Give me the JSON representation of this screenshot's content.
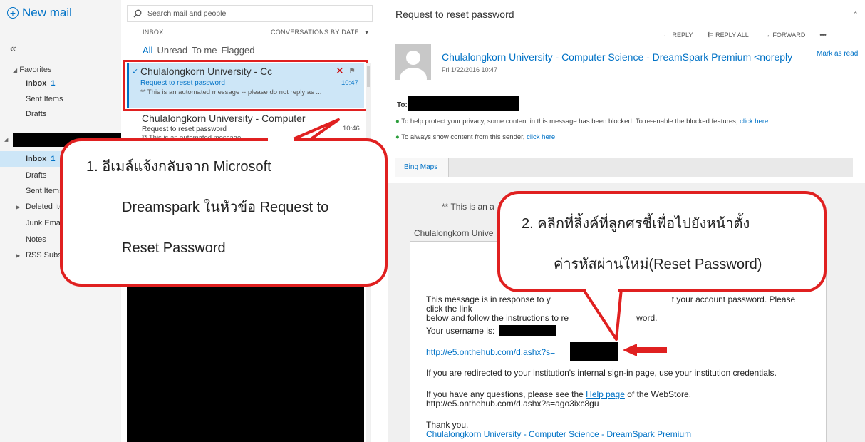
{
  "nav": {
    "new_mail": "New mail",
    "collapse": "«",
    "favorites": "Favorites",
    "fav_items": [
      {
        "label": "Inbox",
        "count": "1"
      },
      {
        "label": "Sent Items",
        "count": ""
      },
      {
        "label": "Drafts",
        "count": ""
      }
    ],
    "folders": [
      {
        "label": "Inbox",
        "count": "1"
      },
      {
        "label": "Drafts",
        "count": ""
      },
      {
        "label": "Sent Items",
        "count": ""
      },
      {
        "label": "Deleted Ite",
        "count": ""
      },
      {
        "label": "Junk Email",
        "count": ""
      },
      {
        "label": "Notes",
        "count": ""
      },
      {
        "label": "RSS Subsc",
        "count": ""
      }
    ]
  },
  "list": {
    "search_placeholder": "Search mail and people",
    "folder_label": "INBOX",
    "sort_label": "CONVERSATIONS BY DATE",
    "filters": [
      "All",
      "Unread",
      "To me",
      "Flagged"
    ],
    "messages": [
      {
        "sender": "Chulalongkorn University - Cc",
        "subject": "Request to reset password",
        "time": "10:47",
        "preview": "** This is an automated message -- please do not reply as ..."
      },
      {
        "sender": "Chulalongkorn University - Computer",
        "subject": "Request to reset password",
        "time": "10:46",
        "preview": "** This is an automated message"
      }
    ]
  },
  "reading": {
    "subject": "Request to reset password",
    "actions": [
      "REPLY",
      "REPLY ALL",
      "FORWARD",
      "•••"
    ],
    "sender": "Chulalongkorn University - Computer Science - DreamSpark Premium <noreply",
    "mark_as_read": "Mark as read",
    "date": "Fri 1/22/2016 10:47",
    "to_label": "To:",
    "notice1_text": "To help protect your privacy, some content in this message has been blocked. To re-enable the blocked features,",
    "notice1_link": "click here.",
    "notice2_text": "To always show content from this sender,",
    "notice2_link": "click here.",
    "tab_label": "Bing Maps",
    "automated_text": "** This is an a",
    "box_header": "Chulalongkorn Unive",
    "p1_a": "This message is in response to y",
    "p1_b": "t your account password. Please click the link",
    "p1_c": "below and follow the instructions to re",
    "p1_d": "word.",
    "username_label": "Your username is:",
    "reset_link": "http://e5.onthehub.com/d.ashx?s=",
    "redirect_text": "If you are redirected to your institution's internal sign-in page, use your institution credentials.",
    "help_text_a": "If you have any questions, please see the",
    "help_link": "Help page",
    "help_text_b": "of the WebStore.",
    "help_url": "http://e5.onthehub.com/d.ashx?s=ago3ixc8gu",
    "thanks": "Thank you,",
    "signature_link": "Chulalongkorn University - Computer Science - DreamSpark Premium"
  },
  "callouts": {
    "c1_line1": "1.  อีเมล์แจ้งกลับจาก Microsoft",
    "c1_line2": "Dreamspark ในหัวข้อ Request to",
    "c1_line3": "Reset Password",
    "c2_line1": "2.  คลิกที่ลิ้งค์ที่ลูกศรชี้เพื่อไปยังหน้าตั้ง",
    "c2_line2": "ค่ารหัสผ่านใหม่(Reset Password)"
  },
  "colors": {
    "accent": "#0072c6",
    "callout_red": "#e02020",
    "selected_bg": "#cde6f7"
  }
}
